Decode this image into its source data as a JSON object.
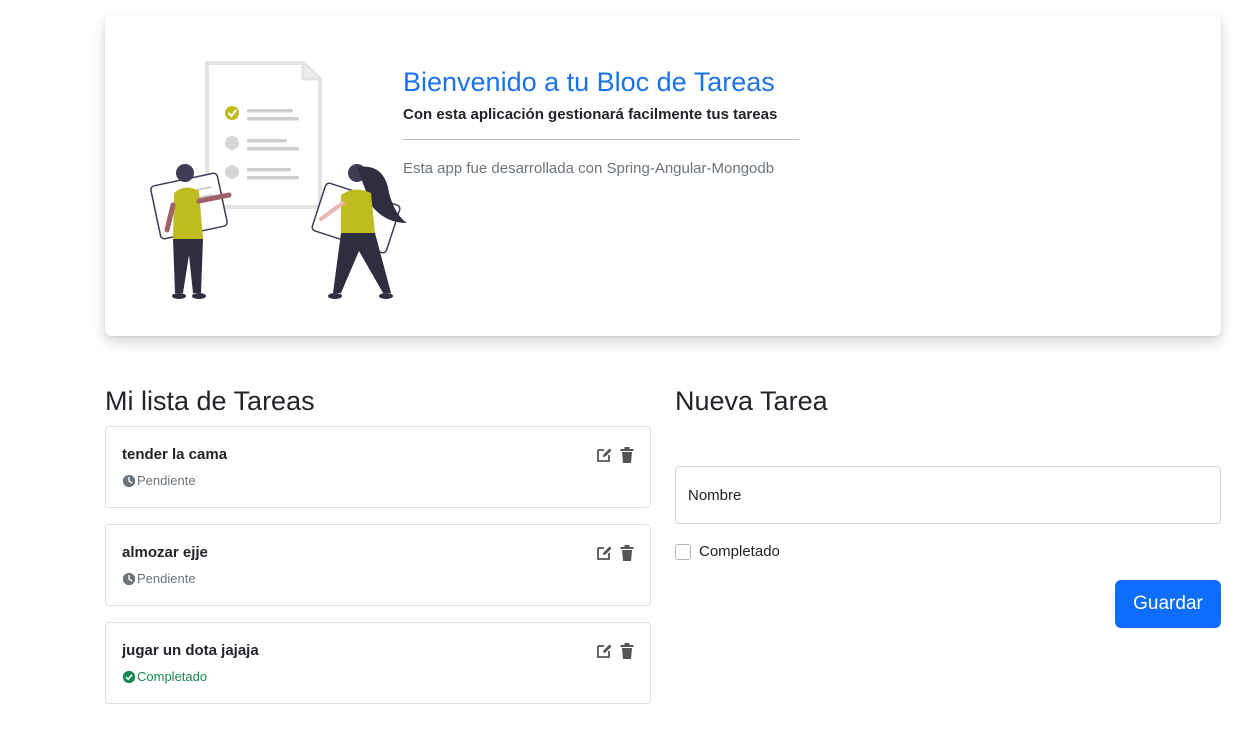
{
  "hero": {
    "title": "Bienvenido a tu Bloc de Tareas",
    "subtitle": "Con esta aplicación gestionará facilmente tus tareas",
    "credit": "Esta app fue desarrollada con Spring-Angular-Mongodb",
    "illustration_icon": "people-with-checklist-illustration"
  },
  "task_list": {
    "title": "Mi lista de Tareas",
    "tasks": [
      {
        "name": "tender la cama",
        "status": "Pendiente",
        "completed": false
      },
      {
        "name": "almozar ejje",
        "status": "Pendiente",
        "completed": false
      },
      {
        "name": "jugar un dota jajaja",
        "status": "Completado",
        "completed": true
      }
    ],
    "icons": {
      "edit": "edit-icon",
      "delete": "trash-icon",
      "pending": "clock-icon",
      "done": "check-circle-icon"
    }
  },
  "form": {
    "title": "Nueva Tarea",
    "name_placeholder": "Nombre",
    "completed_label": "Completado",
    "completed_checked": false,
    "save_label": "Guardar"
  },
  "colors": {
    "primary": "#0d6efd",
    "title_blue": "#1a73e8",
    "success": "#198754",
    "muted": "#6c757d",
    "illustration_accent": "#bfbc1f"
  }
}
